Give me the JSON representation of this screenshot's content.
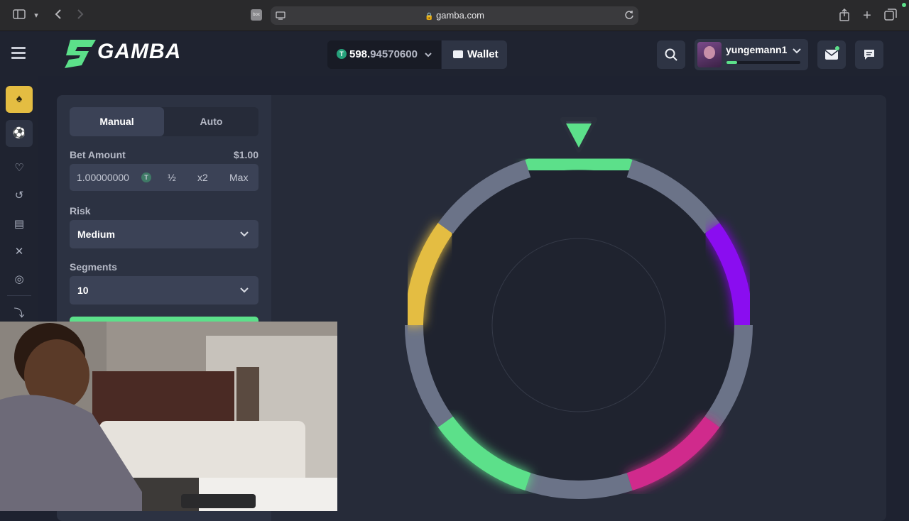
{
  "browser": {
    "url": "gamba.com",
    "favicon_text": "box"
  },
  "header": {
    "logo": "GAMBA",
    "balance_whole": "598.",
    "balance_frac": "94570600",
    "balance_currency_icon": "T",
    "wallet_label": "Wallet",
    "username": "yungemann1",
    "xp_progress": 0.14
  },
  "sidebar": {
    "items": [
      {
        "icon": "cards-icon",
        "active": true
      },
      {
        "icon": "sports-ball-icon",
        "active": false
      },
      {
        "icon": "heart-icon",
        "active": false
      },
      {
        "icon": "history-icon",
        "active": false
      },
      {
        "icon": "chart-icon",
        "active": false
      },
      {
        "icon": "swords-icon",
        "active": false
      },
      {
        "icon": "target-icon",
        "active": false
      },
      {
        "icon": "gamba-logo-icon",
        "active": false
      }
    ]
  },
  "game_panel": {
    "tabs": [
      "Manual",
      "Auto"
    ],
    "active_tab": "Manual",
    "bet_amount_label": "Bet Amount",
    "bet_amount_usd": "$1.00",
    "bet_amount_value": "1.00000000",
    "bet_coin_icon": "T",
    "half_label": "½",
    "double_label": "x2",
    "max_label": "Max",
    "risk_label": "Risk",
    "risk_value": "Medium",
    "segments_label": "Segments",
    "segments_value": "10"
  },
  "wheel": {
    "segments": 10,
    "segment_colors": [
      "#5ce08a",
      "#6b7388",
      "#8a10f0",
      "#6b7388",
      "#d02c8c",
      "#6b7388",
      "#5ce08a",
      "#6b7388",
      "#e4bd42",
      "#6b7388"
    ],
    "pointer_color": "#5ce08a"
  },
  "colors": {
    "accent_green": "#5ce08a",
    "bg": "#1e2230",
    "panel": "#2c3242"
  }
}
